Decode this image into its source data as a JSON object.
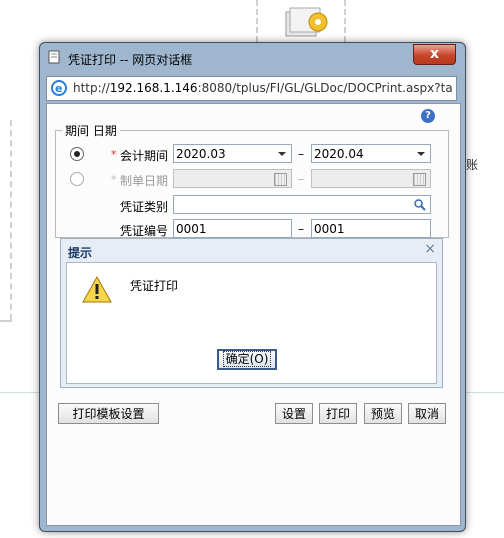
{
  "window": {
    "title": "凭证打印 -- 网页对话框",
    "close_label": "x"
  },
  "address": {
    "prefix": "http://",
    "host": "192.168.1.146",
    "rest": ":8080/tplus/FI/GL/GLDoc/DOCPrint.aspx?taskI"
  },
  "background": {
    "side_text": "账"
  },
  "form": {
    "legend": "期间 日期",
    "help_label": "?",
    "accounting_period": {
      "required_mark": "*",
      "label": "会计期间",
      "from": "2020.03",
      "separator": "–",
      "to": "2020.04",
      "selected": true
    },
    "document_date": {
      "required_mark": "*",
      "label": "制单日期",
      "from": "",
      "separator": "–",
      "to": "",
      "selected": false
    },
    "voucher_type": {
      "label": "凭证类别",
      "value": ""
    },
    "voucher_number": {
      "label": "凭证编号",
      "from": "0001",
      "separator": "–",
      "to": "0001"
    }
  },
  "buttons": {
    "template_settings": "打印模板设置",
    "settings": "设置",
    "print": "打印",
    "preview": "预览",
    "cancel": "取消"
  },
  "alert": {
    "title": "提示",
    "close_label": "×",
    "message": "凭证打印",
    "ok_label": "确定(O)"
  }
}
